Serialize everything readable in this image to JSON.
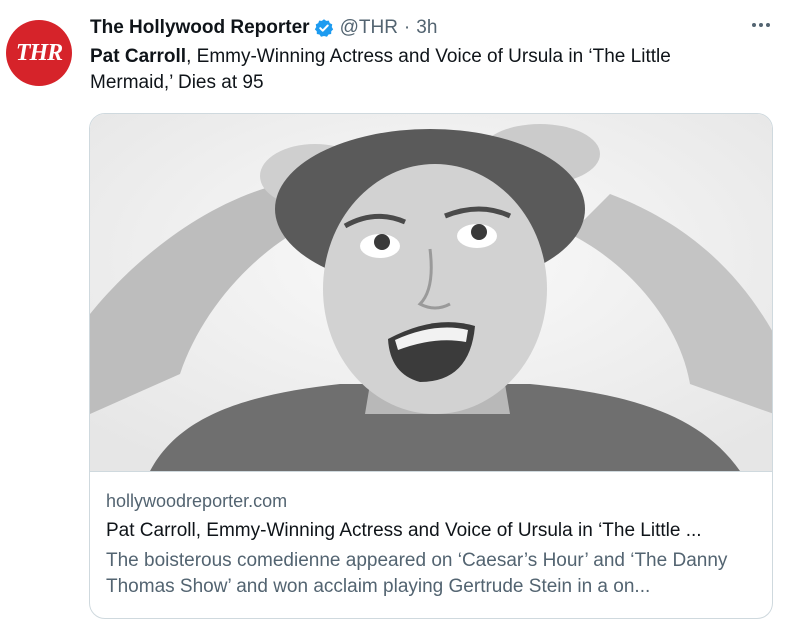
{
  "account": {
    "avatar_text": "THR",
    "name": "The Hollywood Reporter",
    "handle": "@THR",
    "separator": "·",
    "time": "3h"
  },
  "tweet": {
    "text_bold": "Pat Carroll",
    "text_rest": ", Emmy-Winning Actress and Voice of Ursula in ‘The Little Mermaid,’ Dies at 95"
  },
  "card": {
    "domain": "hollywoodreporter.com",
    "title": "Pat Carroll, Emmy-Winning Actress and Voice of Ursula in ‘The Little ...",
    "description": "The boisterous comedienne appeared on ‘Caesar’s Hour’ and ‘The Danny Thomas Show’ and won acclaim playing Gertrude Stein in a on..."
  },
  "colors": {
    "avatar_bg": "#d6232a",
    "verified": "#1d9bf0",
    "secondary_text": "#536471"
  }
}
